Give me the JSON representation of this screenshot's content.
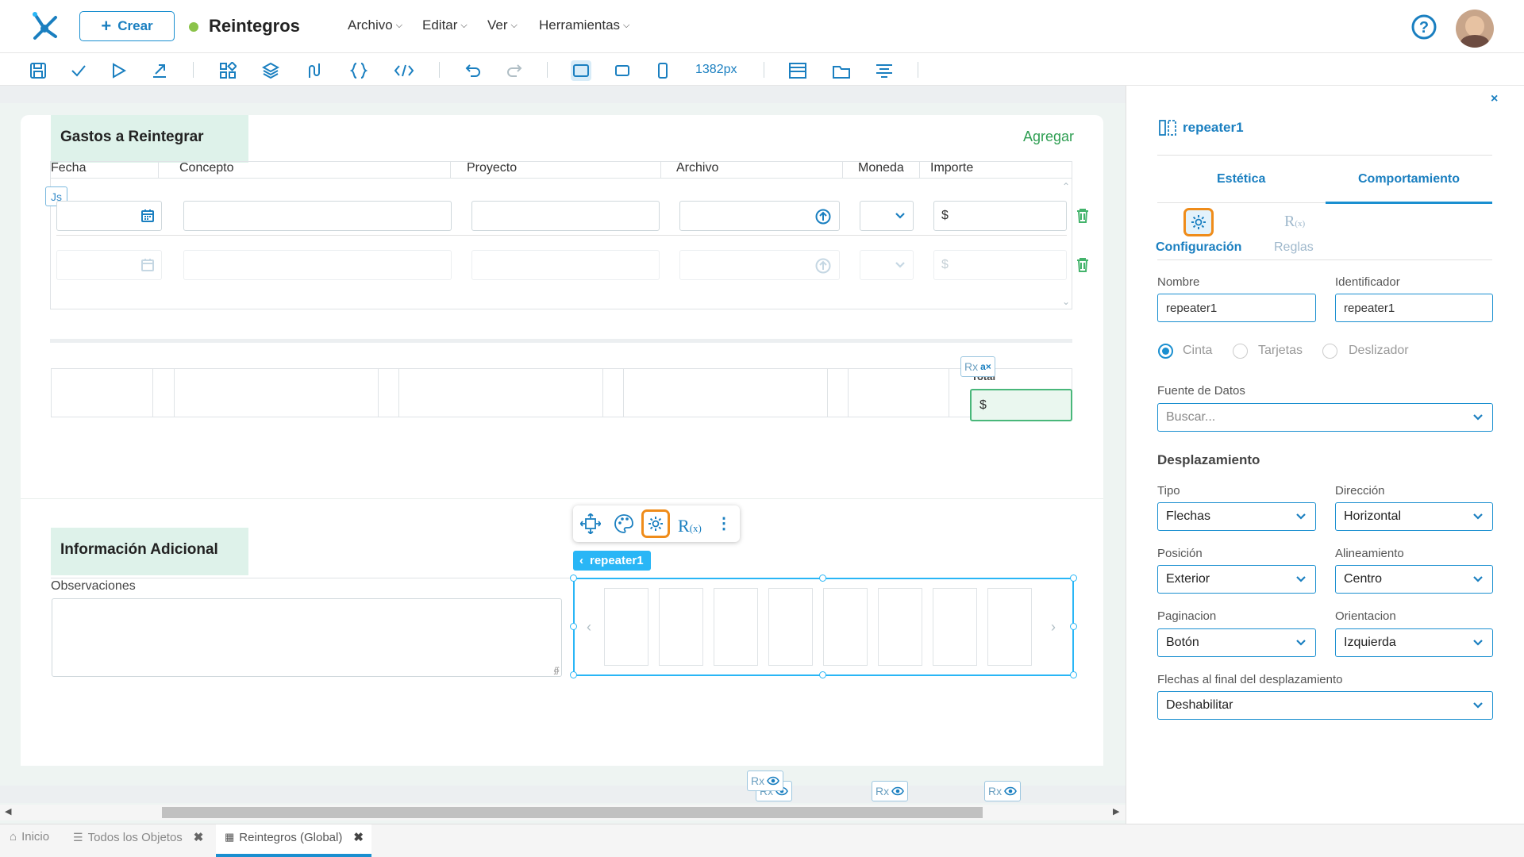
{
  "app": {
    "create_label": "Crear",
    "doc_title": "Reintegros",
    "status_color": "#8bc34a"
  },
  "menu": {
    "archivo": "Archivo",
    "editar": "Editar",
    "ver": "Ver",
    "herramientas": "Herramientas"
  },
  "toolbar": {
    "width_label": "1382px"
  },
  "gastos": {
    "title": "Gastos a Reintegrar",
    "add_label": "Agregar",
    "columns": [
      "Fecha",
      "Concepto",
      "Proyecto",
      "Archivo",
      "Moneda",
      "Importe"
    ],
    "js_badge": "Js",
    "currency_symbol": "$",
    "total_label": "Total",
    "total_value": "$"
  },
  "info": {
    "title": "Información Adicional",
    "obs_label": "Observaciones"
  },
  "floating": {
    "repeater_tag": "repeater1"
  },
  "rx": {
    "label": "Rx"
  },
  "panel": {
    "title": "repeater1",
    "tab_estetica": "Estética",
    "tab_comportamiento": "Comportamiento",
    "sub_config": "Configuración",
    "sub_reglas": "Reglas",
    "nombre_label": "Nombre",
    "nombre_value": "repeater1",
    "identificador_label": "Identificador",
    "identificador_value": "repeater1",
    "radio_cinta": "Cinta",
    "radio_tarjetas": "Tarjetas",
    "radio_deslizador": "Deslizador",
    "fuente_label": "Fuente de Datos",
    "fuente_placeholder": "Buscar...",
    "desplazamiento": "Desplazamiento",
    "tipo_label": "Tipo",
    "tipo_value": "Flechas",
    "direccion_label": "Dirección",
    "direccion_value": "Horizontal",
    "posicion_label": "Posición",
    "posicion_value": "Exterior",
    "alineamiento_label": "Alineamiento",
    "alineamiento_value": "Centro",
    "paginacion_label": "Paginacion",
    "paginacion_value": "Botón",
    "orientacion_label": "Orientacion",
    "orientacion_value": "Izquierda",
    "flechas_label": "Flechas al final del desplazamiento",
    "flechas_value": "Deshabilitar"
  },
  "tabs": {
    "inicio": "Inicio",
    "todos": "Todos los Objetos",
    "reintegros": "Reintegros (Global)"
  },
  "colors": {
    "accent": "#1a8fd0",
    "selection": "#29b6f6",
    "highlight": "#ef8c1a",
    "section_bg": "#def2ea"
  }
}
